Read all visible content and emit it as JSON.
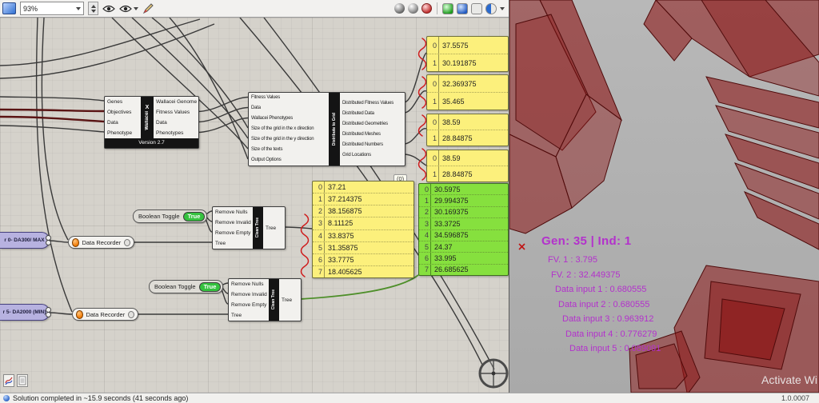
{
  "toolbar": {
    "zoom": "93%",
    "icons": {
      "left": [
        "app-icon",
        "zoom-select",
        "zoom-spinner",
        "preview-eye-icon",
        "preview-eye-menu-icon",
        "sketch-pencil-icon"
      ],
      "right": [
        "preview-off-icon",
        "preview-wireframe-icon",
        "preview-shaded-icon",
        "display-green-icon",
        "display-blue-icon",
        "display-flat-icon",
        "preview-quality-icon"
      ]
    }
  },
  "status": {
    "message": "Solution completed in ~15.9 seconds (41 seconds ago)",
    "version": "1.0.0007"
  },
  "watermark": "Activate Wi",
  "wallacei": {
    "name": "Wallacei",
    "x_label": "X",
    "version": "Version 2.7",
    "inputs": [
      "Genes",
      "Objectives",
      "Data",
      "Phenotype"
    ],
    "outputs": [
      "Wallacei Genomes",
      "Fitness Values",
      "Data",
      "Phenotypes"
    ]
  },
  "distribute": {
    "title": "Distribute to Grid",
    "inputs": [
      "Fitness Values",
      "Data",
      "Wallacei Phenotypes",
      "Size of the grid in the x direction",
      "Size of the grid in the y direction",
      "Size of the texts",
      "Output Options"
    ],
    "outputs": [
      "Distributed Fitness Values",
      "Distributed Data",
      "Distributed Geometries",
      "Distributed Meshes",
      "Distributed Numbers",
      "Grid Locations"
    ]
  },
  "clean_tree": {
    "title": "Clean Tree",
    "inputs": [
      "Remove Nulls",
      "Remove Invalid",
      "Remove Empty",
      "Tree"
    ],
    "outputs": [
      "Tree"
    ]
  },
  "boolean_toggle": {
    "label": "Boolean Toggle",
    "value": "True"
  },
  "data_recorder": {
    "label": "Data Recorder"
  },
  "sliders": {
    "top": "r 0- DA300/ MAX",
    "bottom": "r 5- DA2000 (MIN)"
  },
  "panels": {
    "path_label": "(0)",
    "top": [
      {
        "rows": [
          {
            "i": "0",
            "v": "37.5575"
          },
          {
            "i": "1",
            "v": "30.191875"
          }
        ]
      },
      {
        "rows": [
          {
            "i": "0",
            "v": "32.369375"
          },
          {
            "i": "1",
            "v": "35.465"
          }
        ]
      },
      {
        "rows": [
          {
            "i": "0",
            "v": "38.59"
          },
          {
            "i": "1",
            "v": "28.84875"
          }
        ]
      },
      {
        "rows": [
          {
            "i": "0",
            "v": "38.59"
          },
          {
            "i": "1",
            "v": "28.84875"
          }
        ]
      }
    ],
    "middle": {
      "rows": [
        {
          "i": "0",
          "v": "37.21"
        },
        {
          "i": "1",
          "v": "37.214375"
        },
        {
          "i": "2",
          "v": "38.156875"
        },
        {
          "i": "3",
          "v": "8.11125"
        },
        {
          "i": "4",
          "v": "33.8375"
        },
        {
          "i": "5",
          "v": "31.35875"
        },
        {
          "i": "6",
          "v": "33.7775"
        },
        {
          "i": "7",
          "v": "18.405625"
        }
      ]
    },
    "green": {
      "rows": [
        {
          "i": "0",
          "v": "30.5975"
        },
        {
          "i": "1",
          "v": "29.994375"
        },
        {
          "i": "2",
          "v": "30.169375"
        },
        {
          "i": "3",
          "v": "33.3725"
        },
        {
          "i": "4",
          "v": "34.596875"
        },
        {
          "i": "5",
          "v": "24.37"
        },
        {
          "i": "6",
          "v": "33.995"
        },
        {
          "i": "7",
          "v": "26.685625"
        }
      ]
    }
  },
  "viewport": {
    "header": "Gen: 35 |  Ind: 1",
    "lines": [
      "FV. 1 : 3.795",
      "FV. 2 : 32.449375",
      "Data input 1 : 0.680555",
      "Data input 2 : 0.680555",
      "Data input 3 : 0.963912",
      "Data input 4 : 0.776279",
      "Data input 5 : 0.089091"
    ]
  },
  "colors": {
    "panel_yellow": "#fcf07c",
    "panel_green": "#86e03e",
    "toggle_green": "#35c23f",
    "wire_red": "#5a1414",
    "annotation_red": "#cf1d1d",
    "geometry_red": "#8c1616",
    "stats_magenta": "#b331cc",
    "slider_purple": "#b7b2e0",
    "recorder_orange": "#f07800"
  }
}
